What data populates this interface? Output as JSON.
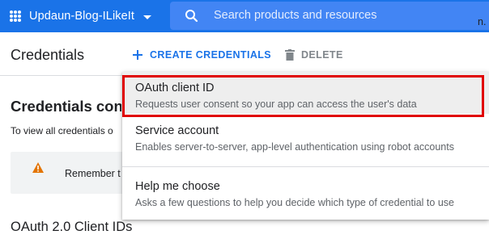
{
  "topbar": {
    "project_name": "Updaun-Blog-ILikeIt",
    "search_placeholder": "Search products and resources"
  },
  "header": {
    "title": "Credentials",
    "create_label": "CREATE CREDENTIALS",
    "delete_label": "DELETE"
  },
  "main": {
    "section_title": "Credentials con",
    "section_subtitle": "To view all credentials o",
    "notice_text": "Remember t",
    "notice_end": "n.",
    "oauth_title": "OAuth 2.0 Client IDs"
  },
  "menu": {
    "items": [
      {
        "title": "OAuth client ID",
        "description": "Requests user consent so your app can access the user's data"
      },
      {
        "title": "Service account",
        "description": "Enables server-to-server, app-level authentication using robot accounts"
      },
      {
        "title": "Help me choose",
        "description": "Asks a few questions to help you decide which type of credential to use"
      }
    ]
  },
  "colors": {
    "topbar": "#1a73e8",
    "search_bg": "#4285f4",
    "accent": "#1a73e8",
    "highlight": "#e00000",
    "warning": "#e37400"
  },
  "icons": [
    "project-dots-icon",
    "search-icon",
    "plus-icon",
    "trash-icon",
    "warning-icon",
    "chevron-down-icon"
  ]
}
